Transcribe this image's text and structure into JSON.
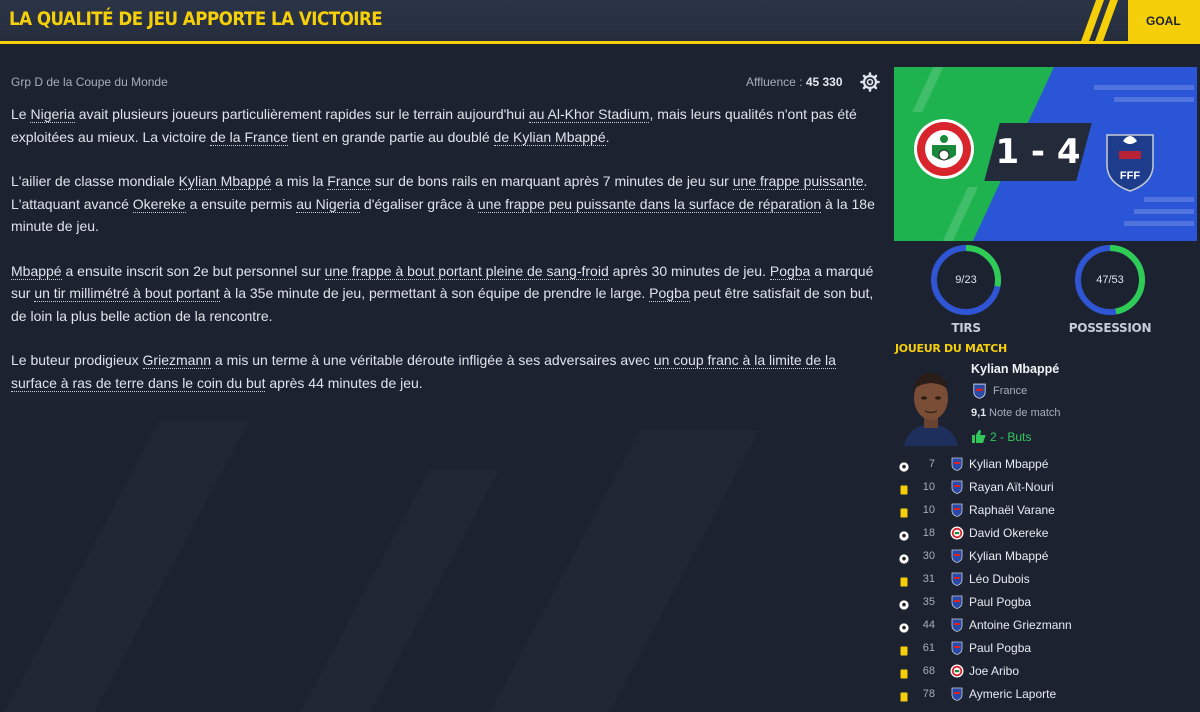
{
  "header": {
    "title": "LA QUALITÉ DE JEU APPORTE LA VICTOIRE",
    "tab": "GOAL"
  },
  "match": {
    "competition": "Grp D de la Coupe du Monde",
    "attendance_label": "Affluence :",
    "attendance_value": "45 330",
    "score": "1 - 4"
  },
  "article": {
    "p1": [
      {
        "t": "Le "
      },
      {
        "t": "Nigeria",
        "u": true
      },
      {
        "t": " avait plusieurs joueurs particulièrement rapides sur le terrain aujourd'hui "
      },
      {
        "t": "au Al-Khor Stadium",
        "u": true
      },
      {
        "t": ", mais leurs qualités n'ont pas été exploitées au mieux. La victoire "
      },
      {
        "t": "de la France",
        "u": true
      },
      {
        "t": " tient en grande partie au doublé "
      },
      {
        "t": "de Kylian Mbappé",
        "u": true
      },
      {
        "t": "."
      }
    ],
    "p2": [
      {
        "t": "L'ailier de classe mondiale "
      },
      {
        "t": "Kylian Mbappé",
        "u": true
      },
      {
        "t": " a mis la "
      },
      {
        "t": "France",
        "u": true
      },
      {
        "t": " sur de bons rails en marquant après 7 minutes de jeu sur "
      },
      {
        "t": "une frappe puissante",
        "u": true
      },
      {
        "t": ". L'attaquant avancé "
      },
      {
        "t": "Okereke",
        "u": true
      },
      {
        "t": " a ensuite permis "
      },
      {
        "t": "au Nigeria",
        "u": true
      },
      {
        "t": " d'égaliser grâce à "
      },
      {
        "t": "une frappe peu puissante dans la surface de réparation",
        "u": true
      },
      {
        "t": " à la 18e minute de jeu."
      }
    ],
    "p3": [
      {
        "t": "Mbappé",
        "u": true
      },
      {
        "t": " a ensuite inscrit son 2e but personnel sur "
      },
      {
        "t": "une frappe à bout portant pleine de sang-froid",
        "u": true
      },
      {
        "t": " après 30 minutes de jeu. "
      },
      {
        "t": "Pogba",
        "u": true
      },
      {
        "t": " a marqué sur "
      },
      {
        "t": "un tir millimétré à bout portant",
        "u": true
      },
      {
        "t": " à la 35e minute de jeu, permettant à son équipe de prendre le large. "
      },
      {
        "t": "Pogba",
        "u": true
      },
      {
        "t": " peut être satisfait de son but, de loin la plus belle action de la rencontre."
      }
    ],
    "p4": [
      {
        "t": "Le buteur prodigieux "
      },
      {
        "t": "Griezmann",
        "u": true
      },
      {
        "t": " a mis un terme à une véritable déroute infligée à ses adversaires avec "
      },
      {
        "t": "un coup franc à la limite de la surface à ras de terre dans le coin du but",
        "u": true
      },
      {
        "t": " après 44 minutes de jeu."
      }
    ]
  },
  "stats": {
    "shots": {
      "label": "TIRS",
      "value": "9/23",
      "home": 9,
      "away": 23
    },
    "possession": {
      "label": "POSSESSION",
      "value": "47/53",
      "home": 47,
      "away": 53
    },
    "home_color": "#2ecc55",
    "away_color": "#2f55d4"
  },
  "potm": {
    "title": "JOUEUR DU MATCH",
    "name": "Kylian Mbappé",
    "country": "France",
    "rating": "9,1",
    "rating_label": "Note de match",
    "goals": "2 - Buts"
  },
  "events": [
    {
      "type": "goal",
      "minute": "7",
      "team": "fr",
      "player": "Kylian Mbappé"
    },
    {
      "type": "yellow",
      "minute": "10",
      "team": "fr",
      "player": "Rayan Aït-Nouri"
    },
    {
      "type": "yellow",
      "minute": "10",
      "team": "fr",
      "player": "Raphaël Varane"
    },
    {
      "type": "goal",
      "minute": "18",
      "team": "ng",
      "player": "David Okereke"
    },
    {
      "type": "goal",
      "minute": "30",
      "team": "fr",
      "player": "Kylian Mbappé"
    },
    {
      "type": "yellow",
      "minute": "31",
      "team": "fr",
      "player": "Léo Dubois"
    },
    {
      "type": "goal",
      "minute": "35",
      "team": "fr",
      "player": "Paul Pogba"
    },
    {
      "type": "goal",
      "minute": "44",
      "team": "fr",
      "player": "Antoine Griezmann"
    },
    {
      "type": "yellow",
      "minute": "61",
      "team": "fr",
      "player": "Paul Pogba"
    },
    {
      "type": "yellow",
      "minute": "68",
      "team": "ng",
      "player": "Joe Aribo"
    },
    {
      "type": "yellow",
      "minute": "78",
      "team": "fr",
      "player": "Aymeric Laporte"
    }
  ]
}
